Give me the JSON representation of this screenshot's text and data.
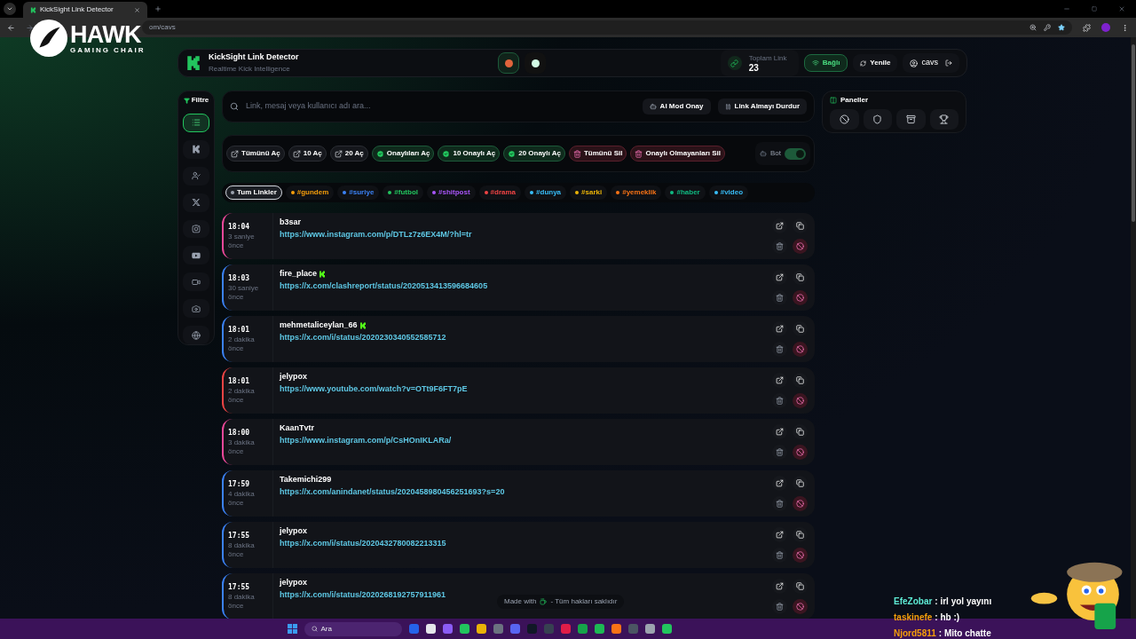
{
  "browser": {
    "tab_title": "KickSight Link Detector",
    "address": "om/cavs"
  },
  "overlay_logo": {
    "title": "HAWK",
    "subtitle": "GAMING CHAIR"
  },
  "header": {
    "app_name": "KickSight Link Detector",
    "tagline": "Realtime Kick Intelligence",
    "stat_label": "Toplam Link",
    "stat_value": "23",
    "connection": {
      "label": "Bağlı",
      "connected": true
    },
    "refresh": "Yenile",
    "user": "cavs"
  },
  "filter": {
    "title": "Filtre",
    "items": [
      {
        "kind": "all",
        "selected": true
      },
      {
        "kind": "kick",
        "selected": false
      },
      {
        "kind": "user",
        "selected": false
      },
      {
        "kind": "x",
        "selected": false
      },
      {
        "kind": "instagram",
        "selected": false
      },
      {
        "kind": "youtube",
        "selected": false
      },
      {
        "kind": "video",
        "selected": false
      },
      {
        "kind": "camera",
        "selected": false
      },
      {
        "kind": "web",
        "selected": false
      }
    ]
  },
  "search": {
    "placeholder": "Link, mesaj veya kullanıcı adı ara...",
    "buttons": [
      {
        "kind": "bot",
        "label": "AI Mod Onay"
      },
      {
        "kind": "pause",
        "label": "Link Almayı Durdur"
      }
    ]
  },
  "actions": [
    {
      "kind": "open",
      "label": "Tümünü Aç"
    },
    {
      "kind": "open",
      "label": "10 Aç"
    },
    {
      "kind": "open",
      "label": "20 Aç"
    },
    {
      "kind": "approved",
      "label": "Onaylıları Aç"
    },
    {
      "kind": "approved",
      "label": "10 Onaylı Aç"
    },
    {
      "kind": "approved",
      "label": "20 Onaylı Aç"
    },
    {
      "kind": "delete",
      "label": "Tümünü Sil"
    },
    {
      "kind": "delete",
      "label": "Onaylı Olmayanları Sil"
    }
  ],
  "bot": {
    "label": "Bot",
    "on": true
  },
  "tags": [
    {
      "label": "Tum Linkler",
      "color": "#9ca3af",
      "selected": true
    },
    {
      "label": "#gundem",
      "color": "#f59e0b",
      "selected": false
    },
    {
      "label": "#suriye",
      "color": "#3b82f6",
      "selected": false
    },
    {
      "label": "#futbol",
      "color": "#22c55e",
      "selected": false
    },
    {
      "label": "#shitpost",
      "color": "#a855f7",
      "selected": false
    },
    {
      "label": "#drama",
      "color": "#ef4444",
      "selected": false
    },
    {
      "label": "#dunya",
      "color": "#38bdf8",
      "selected": false
    },
    {
      "label": "#sarki",
      "color": "#eab308",
      "selected": false
    },
    {
      "label": "#yemeklik",
      "color": "#f97316",
      "selected": false
    },
    {
      "label": "#haber",
      "color": "#10b981",
      "selected": false
    },
    {
      "label": "#video",
      "color": "#38bdf8",
      "selected": false
    }
  ],
  "links": [
    {
      "time": "18:04",
      "ago": "3 saniye önce",
      "user": "b3sar",
      "verified": false,
      "url": "https://www.instagram.com/p/DTLz7z6EX4M/?hl=tr",
      "color": "#ec4899"
    },
    {
      "time": "18:03",
      "ago": "30 saniye önce",
      "user": "fire_place",
      "verified": true,
      "url": "https://x.com/clashreport/status/2020513413596684605",
      "color": "#3b82f6"
    },
    {
      "time": "18:01",
      "ago": "2 dakika önce",
      "user": "mehmetaliceylan_66",
      "verified": true,
      "url": "https://x.com/i/status/2020230340552585712",
      "color": "#3b82f6"
    },
    {
      "time": "18:01",
      "ago": "2 dakika önce",
      "user": "jelypox",
      "verified": false,
      "url": "https://www.youtube.com/watch?v=OTt9F6FT7pE",
      "color": "#ef4444"
    },
    {
      "time": "18:00",
      "ago": "3 dakika önce",
      "user": "KaanTvtr",
      "verified": false,
      "url": "https://www.instagram.com/p/CsHOnIKLARa/",
      "color": "#ec4899"
    },
    {
      "time": "17:59",
      "ago": "4 dakika önce",
      "user": "Takemichi299",
      "verified": false,
      "url": "https://x.com/anindanet/status/2020458980456251693?s=20",
      "color": "#3b82f6"
    },
    {
      "time": "17:55",
      "ago": "8 dakika önce",
      "user": "jelypox",
      "verified": false,
      "url": "https://x.com/i/status/2020432780082213315",
      "color": "#3b82f6"
    },
    {
      "time": "17:55",
      "ago": "8 dakika önce",
      "user": "jelypox",
      "verified": false,
      "url": "https://x.com/i/status/2020268192757911961",
      "color": "#3b82f6"
    }
  ],
  "panels": {
    "title": "Paneller",
    "buttons": [
      {
        "kind": "block"
      },
      {
        "kind": "shield"
      },
      {
        "kind": "archive"
      },
      {
        "kind": "trophy"
      }
    ]
  },
  "footer": {
    "before": "Made with",
    "after": "- Tüm hakları saklıdır"
  },
  "chat": [
    {
      "user": "EfeZobar",
      "color": "#5eead4",
      "message": ": irl yol yayını"
    },
    {
      "user": "taskinefe",
      "color": "#f59e0b",
      "message": ": hb :)"
    },
    {
      "user": "Njord5811",
      "color": "#f59e0b",
      "message": ": Mito chatte"
    }
  ],
  "taskbar": {
    "search": "Ara"
  }
}
